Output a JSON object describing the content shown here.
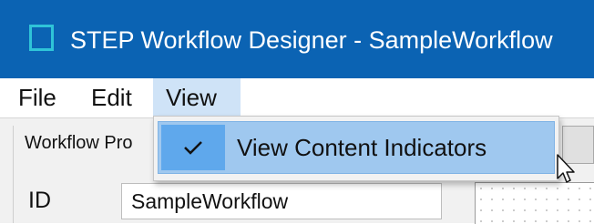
{
  "window": {
    "title": "STEP Workflow Designer - SampleWorkflow",
    "app_icon": "square-outline-icon"
  },
  "menubar": {
    "items": [
      {
        "label": "File"
      },
      {
        "label": "Edit"
      },
      {
        "label": "View"
      }
    ]
  },
  "view_menu": {
    "items": [
      {
        "label": "View Content Indicators",
        "checked": true,
        "icon": "checkmark-icon"
      }
    ]
  },
  "properties_panel": {
    "title": "Workflow Pro",
    "id_label": "ID",
    "id_value": "SampleWorkflow"
  },
  "colors": {
    "titlebar": "#0b63b3",
    "menu_highlight": "#9fc8ef",
    "check_highlight": "#5fa8ec"
  }
}
